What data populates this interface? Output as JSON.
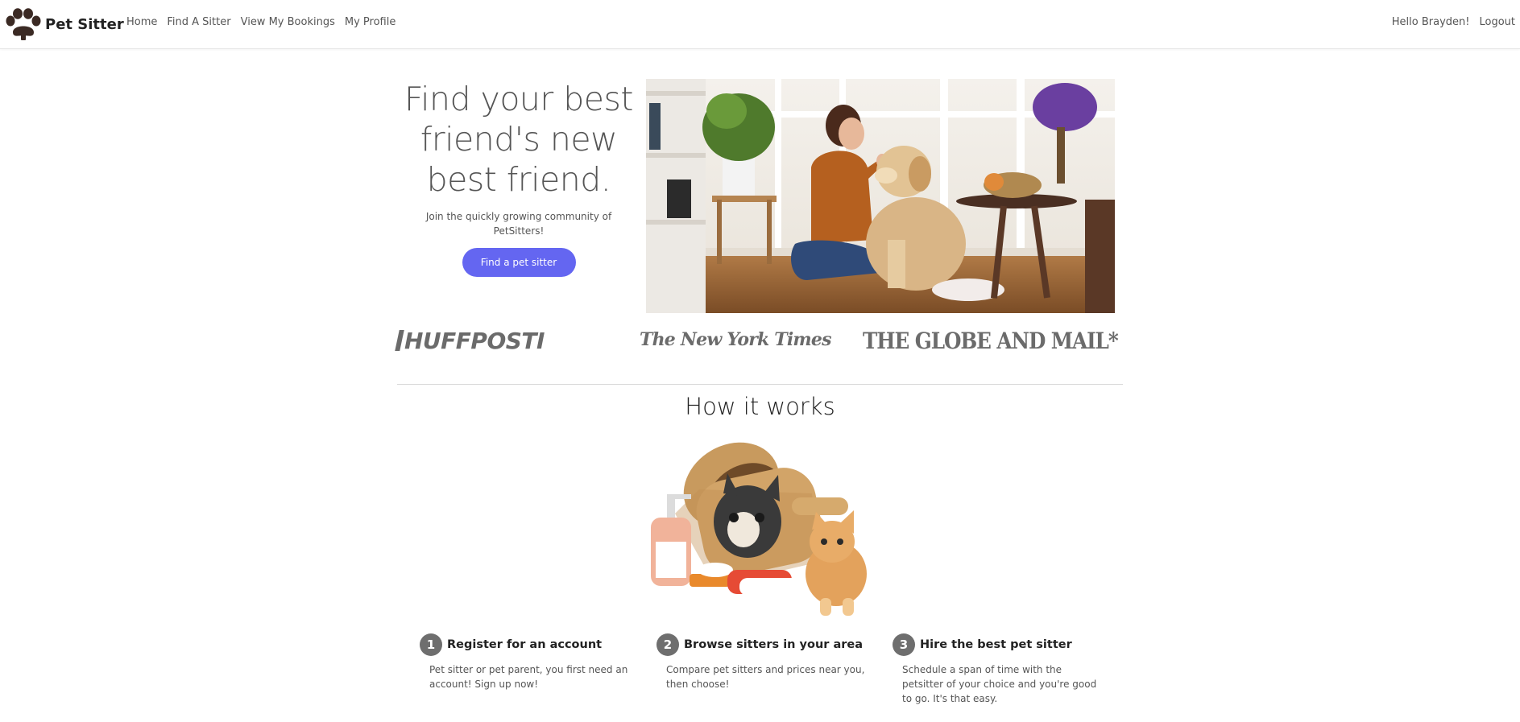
{
  "navbar": {
    "brand": "Pet Sitter",
    "links": [
      "Home",
      "Find A Sitter",
      "View My Bookings",
      "My Profile"
    ],
    "greeting": "Hello Brayden!",
    "logout": "Logout"
  },
  "hero": {
    "title": "Find your best friend's new best friend.",
    "subtitle": "Join the quickly growing community of PetSitters!",
    "cta": "Find a pet sitter"
  },
  "press": {
    "huffpost": "HUFFPOSTI",
    "nyt": "The New York Times",
    "globe": "THE GLOBE AND MAIL*"
  },
  "how": {
    "title": "How it works",
    "steps": [
      {
        "num": "1",
        "title": "Register for an account",
        "desc": "Pet sitter or pet parent, you first need an account! Sign up now!"
      },
      {
        "num": "2",
        "title": "Browse sitters in your area",
        "desc": "Compare pet sitters and prices near you, then choose!"
      },
      {
        "num": "3",
        "title": "Hire the best pet sitter",
        "desc": "Schedule a span of time with the petsitter of your choice and you're good to go. It's that easy."
      }
    ]
  },
  "colors": {
    "accent": "#6466f1",
    "badge": "#6e6e6e"
  },
  "icons": {
    "brand": "paw-print-icon"
  }
}
